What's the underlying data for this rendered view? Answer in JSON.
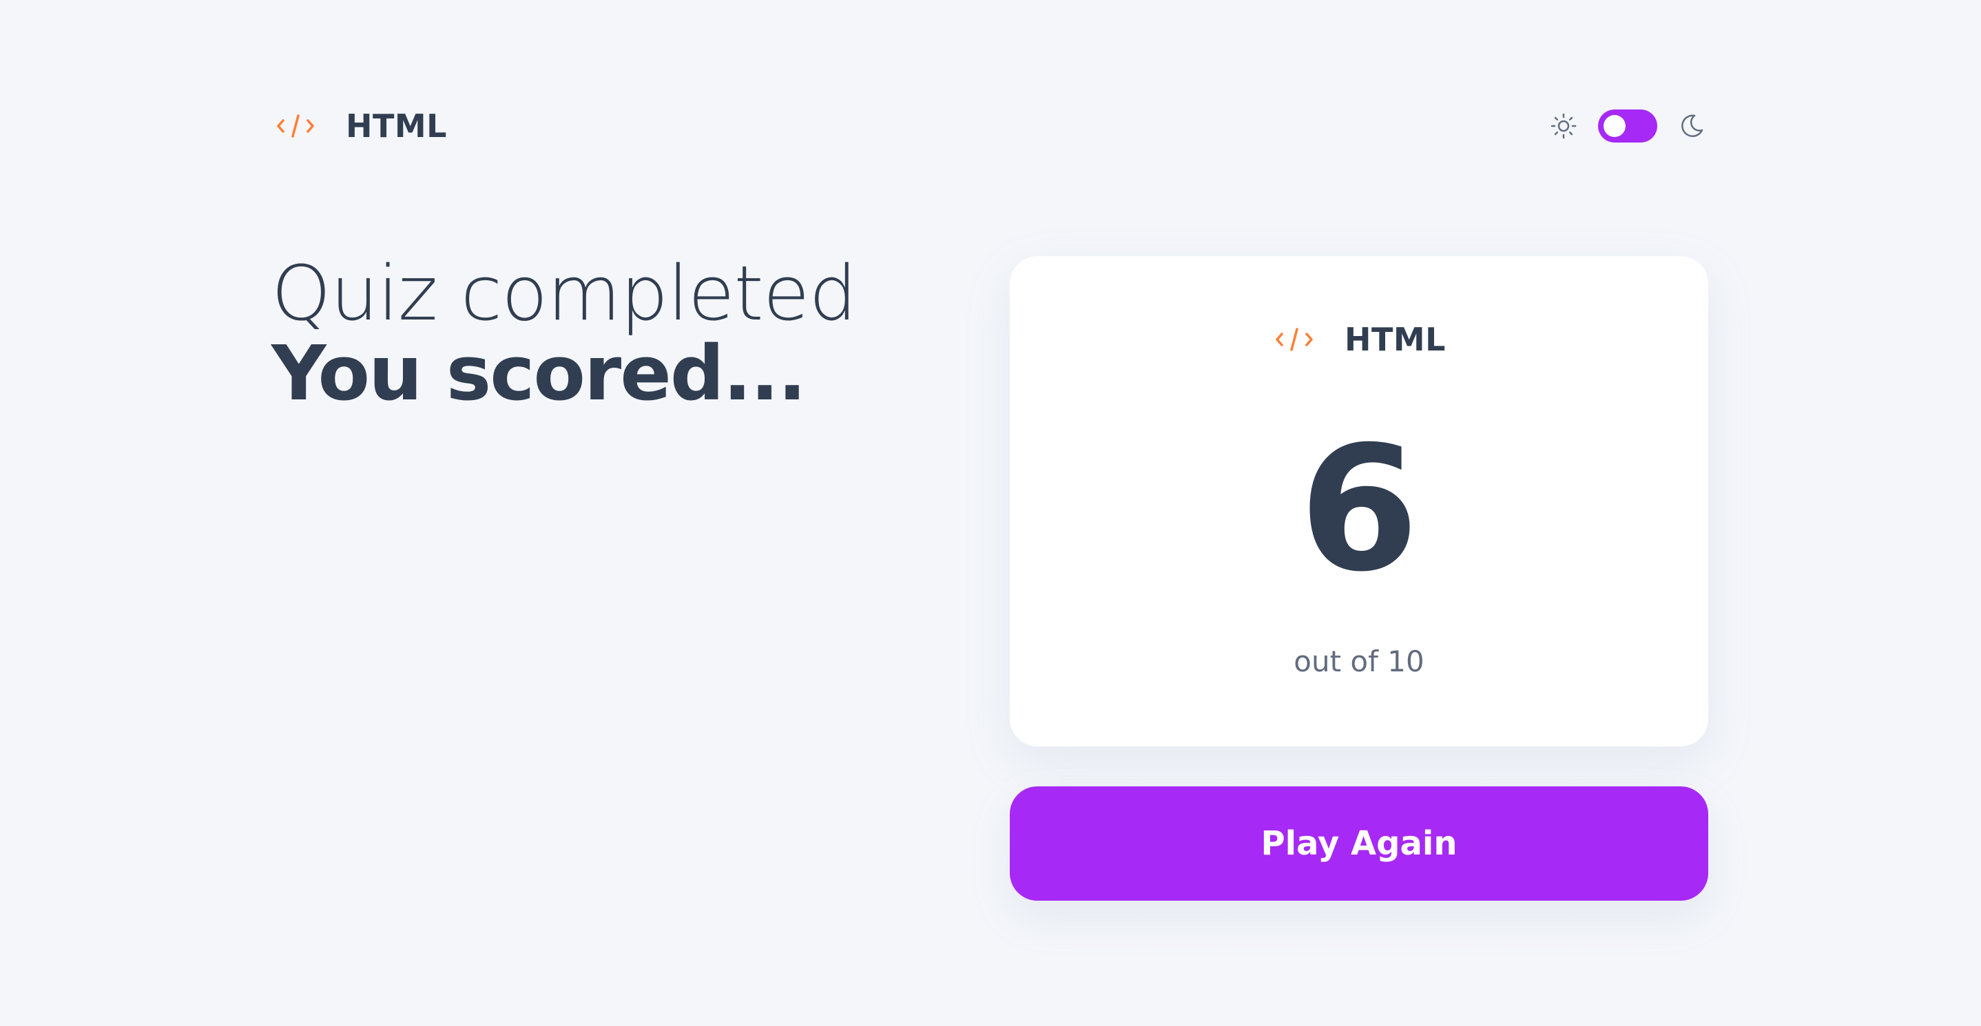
{
  "header": {
    "subject": "HTML",
    "subject_icon": "code-brackets-icon",
    "theme": {
      "light_icon": "sun-icon",
      "dark_icon": "moon-icon",
      "mode": "light"
    }
  },
  "heading": {
    "line1": "Quiz completed",
    "line2": "You scored..."
  },
  "score_card": {
    "subject": "HTML",
    "subject_icon": "code-brackets-icon",
    "score": "6",
    "out_of": "out of 10"
  },
  "actions": {
    "play_again": "Play Again"
  },
  "colors": {
    "background": "#F4F6FA",
    "text_dark": "#313E51",
    "text_muted": "#626C7F",
    "accent_purple": "#A729F5",
    "html_orange": "#FF7E35",
    "card": "#FFFFFF"
  }
}
